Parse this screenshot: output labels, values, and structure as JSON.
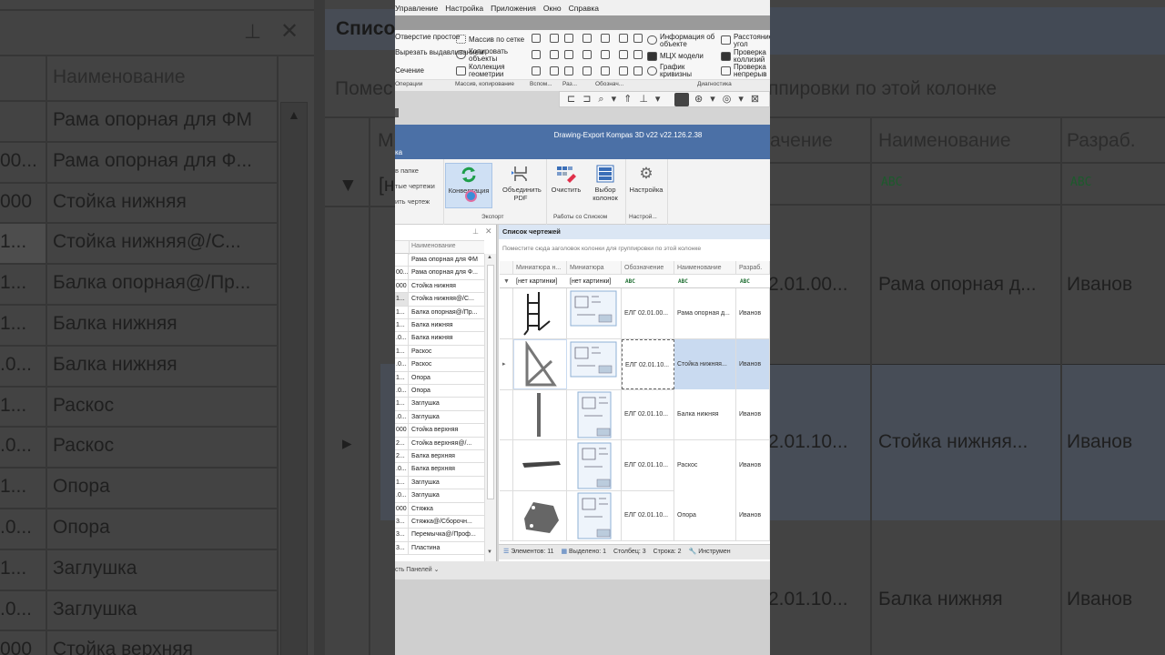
{
  "background_left": {
    "panel_header_pin": "pin-icon",
    "column_header": "Наименование",
    "list_title_partial": "Списо",
    "group_hint_partial": "Помес",
    "column_partial": "М",
    "filter_partial": "[н",
    "rows": [
      {
        "code": "",
        "name": "Рама опорная для ФМ"
      },
      {
        "code": "00...",
        "name": "Рама опорная для Ф..."
      },
      {
        "code": "000",
        "name": "Стойка нижняя"
      },
      {
        "code": "1...",
        "name": "Стойка нижняя@/С..."
      },
      {
        "code": "1...",
        "name": "Балка опорная@/Пр..."
      },
      {
        "code": "1...",
        "name": "Балка нижняя"
      },
      {
        "code": ".0...",
        "name": "Балка нижняя"
      },
      {
        "code": "1...",
        "name": "Раскос"
      },
      {
        "code": ".0...",
        "name": "Раскос"
      },
      {
        "code": "1...",
        "name": "Опора"
      },
      {
        "code": ".0...",
        "name": "Опора"
      },
      {
        "code": "1...",
        "name": "Заглушка"
      },
      {
        "code": ".0...",
        "name": "Заглушка"
      },
      {
        "code": "000",
        "name": "Стойка верхняя"
      }
    ]
  },
  "background_right": {
    "group_hint_partial": "ппировки по этой колонке",
    "headers": [
      "ачение",
      "Наименование",
      "Разраб."
    ],
    "rows": [
      {
        "code": "2.01.00...",
        "name": "Рама опорная д...",
        "author": "Иванов"
      },
      {
        "code": "2.01.10...",
        "name": "Стойка нижняя...",
        "author": "Иванов"
      },
      {
        "code": "2.01.10...",
        "name": "Балка нижняя",
        "author": "Иванов"
      }
    ]
  },
  "menu": [
    "Управление",
    "Настройка",
    "Приложения",
    "Окно",
    "Справка"
  ],
  "kompas_ribbon": {
    "operations": [
      "Отверстие простое",
      "Вырезать выдавливанием",
      "Сечение"
    ],
    "array": [
      "Массив по сетке",
      "Копировать объекты",
      "Коллекция геометрии"
    ],
    "diagnostics": [
      "Информация об объекте",
      "МЦХ модели",
      "График кривизны"
    ],
    "diagnostics2": [
      "Расстояние угол",
      "Проверка коллизий",
      "Проверка непрерыв"
    ],
    "groups": [
      "Операции",
      "Массив, копирование",
      "Вспом...",
      "Раз...",
      "Обознач...",
      "Диагностика"
    ]
  },
  "app_title": "Drawing-Export Kompas 3D v22 v22.126.2.38",
  "tab_partial": "ка",
  "plugin_ribbon": {
    "left_items": [
      "в папке",
      "тые чертежи",
      "ить чертеж"
    ],
    "buttons": [
      "Конвертация",
      "Объединить PDF",
      "Очистить",
      "Выбор колонок",
      "Настройка"
    ],
    "groups": [
      "Экспорт",
      "Работы со Списком",
      "Настрой..."
    ]
  },
  "left_panel": {
    "column_header": "Наименование",
    "rows": [
      {
        "code": "",
        "name": "Рама опорная для ФМ"
      },
      {
        "code": "00...",
        "name": "Рама опорная для Ф..."
      },
      {
        "code": "000",
        "name": "Стойка нижняя"
      },
      {
        "code": "1...",
        "name": "Стойка нижняя@/С..."
      },
      {
        "code": "1...",
        "name": "Балка опорная@/Пр..."
      },
      {
        "code": "1...",
        "name": "Балка нижняя"
      },
      {
        "code": ".0...",
        "name": "Балка нижняя"
      },
      {
        "code": "1...",
        "name": "Раскос"
      },
      {
        "code": ".0...",
        "name": "Раскос"
      },
      {
        "code": "1...",
        "name": "Опора"
      },
      {
        "code": ".0...",
        "name": "Опора"
      },
      {
        "code": "1...",
        "name": "Заглушка"
      },
      {
        "code": ".0...",
        "name": "Заглушка"
      },
      {
        "code": "000",
        "name": "Стойка верхняя"
      },
      {
        "code": "2...",
        "name": "Стойка верхняя@/..."
      },
      {
        "code": "2...",
        "name": "Балка верхняя"
      },
      {
        "code": ".0...",
        "name": "Балка верхняя"
      },
      {
        "code": "1...",
        "name": "Заглушка"
      },
      {
        "code": ".0...",
        "name": "Заглушка"
      },
      {
        "code": "000",
        "name": "Стяжка"
      },
      {
        "code": "3...",
        "name": "Стяжка@/Сборочн..."
      },
      {
        "code": "3...",
        "name": "Перемычка@/Проф..."
      },
      {
        "code": "3...",
        "name": "Пластина"
      }
    ]
  },
  "drawings": {
    "title": "Список чертежей",
    "group_hint": "Поместите сюда заголовок колонки для группировки по этой колонке",
    "headers": [
      "Миниатюра н...",
      "Миниатюра",
      "Обозначение",
      "Наименование",
      "Разраб."
    ],
    "filter": [
      "[нет картинки]",
      "[нет картинки]"
    ],
    "filter_icon": "abc-filter-icon",
    "filter_abc": "ABC",
    "rows": [
      {
        "code": "ЕЛГ 02.01.00...",
        "name": "Рама опорная д...",
        "author": "Иванов",
        "shape": "frame"
      },
      {
        "code": "ЕЛГ 02.01.10...",
        "name": "Стойка нижняя...",
        "author": "Иванов",
        "shape": "triangle"
      },
      {
        "code": "ЕЛГ 02.01.10...",
        "name": "Балка нижняя",
        "author": "Иванов",
        "shape": "beam"
      },
      {
        "code": "ЕЛГ 02.01.10...",
        "name": "Раскос",
        "author": "Иванов",
        "shape": "brace"
      },
      {
        "code": "ЕЛГ 02.01.10...",
        "name": "Опора",
        "author": "Иванов",
        "shape": "plate"
      }
    ],
    "selected_row": 1
  },
  "status": {
    "elements_label": "Элементов:",
    "elements": "11",
    "selected_label": "Выделено:",
    "selected": "1",
    "column_label": "Столбец:",
    "column": "3",
    "row_label": "Строка:",
    "row": "2",
    "tools": "Инструмен"
  },
  "bottom_bar": "сть Панелей ⌄",
  "colors": {
    "title_bar": "#4b70a6",
    "selected_row": "#c9daf0",
    "accent_green": "#1e9e4a"
  }
}
